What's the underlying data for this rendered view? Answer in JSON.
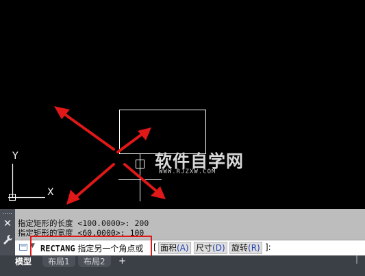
{
  "viewport": {
    "ucs_icon": {
      "y_label": "Y",
      "x_label": "X"
    },
    "watermark": {
      "title": "软件自学网",
      "url": "WWW.RJZXW.COM"
    }
  },
  "command_window": {
    "history": [
      "指定矩形的长度 <100.0000>: 200",
      "指定矩形的宽度 <60.0000>: 100"
    ],
    "current_command": "RECTANG",
    "prompt": "指定另一个角点或",
    "options_open": "[",
    "options": [
      {
        "label": "面积",
        "key": "(A)"
      },
      {
        "label": "尺寸",
        "key": "(D)"
      },
      {
        "label": "旋转",
        "key": "(R)"
      }
    ],
    "options_close": "]:"
  },
  "layout_tabs": {
    "tabs": [
      "模型",
      "布局1",
      "布局2"
    ],
    "active": "模型",
    "add_label": "+"
  },
  "colors": {
    "annotation_red": "#e01818",
    "background": "#000000",
    "cad_line": "#ffffff"
  }
}
